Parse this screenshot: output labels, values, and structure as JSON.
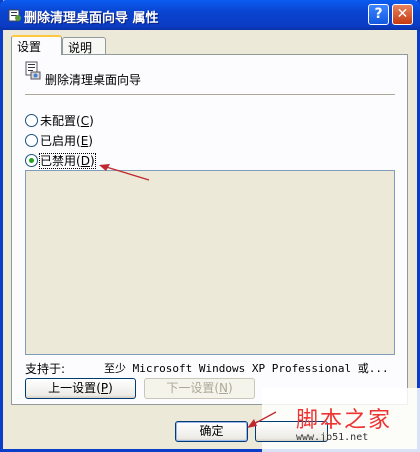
{
  "window": {
    "title": "删除清理桌面向导 属性"
  },
  "titlebar_buttons": {
    "help": "?",
    "close": "✕"
  },
  "tabs": [
    {
      "label": "设置",
      "active": true
    },
    {
      "label": "说明",
      "active": false
    }
  ],
  "setting": {
    "name": "删除清理桌面向导",
    "icon": "policy-setting-icon"
  },
  "options": [
    {
      "label": "未配置",
      "hotkey": "C",
      "checked": false
    },
    {
      "label": "已启用",
      "hotkey": "E",
      "checked": false
    },
    {
      "label": "已禁用",
      "hotkey": "D",
      "checked": true
    }
  ],
  "support": {
    "label": "支持于:",
    "value": "至少 Microsoft Windows XP Professional 或..."
  },
  "nav_buttons": {
    "prev": {
      "label": "上一设置",
      "hotkey": "P"
    },
    "next": {
      "label": "下一设置",
      "hotkey": "N",
      "disabled": true
    }
  },
  "dialog_buttons": {
    "ok": "确定"
  },
  "watermark": {
    "text": "脚本之家",
    "url": "www.jb51.net"
  },
  "colors": {
    "titlebar": "#0A44D0",
    "dialog_bg": "#ECE9D8",
    "annotation_arrow": "#C0282D",
    "watermark": "#E33333"
  }
}
